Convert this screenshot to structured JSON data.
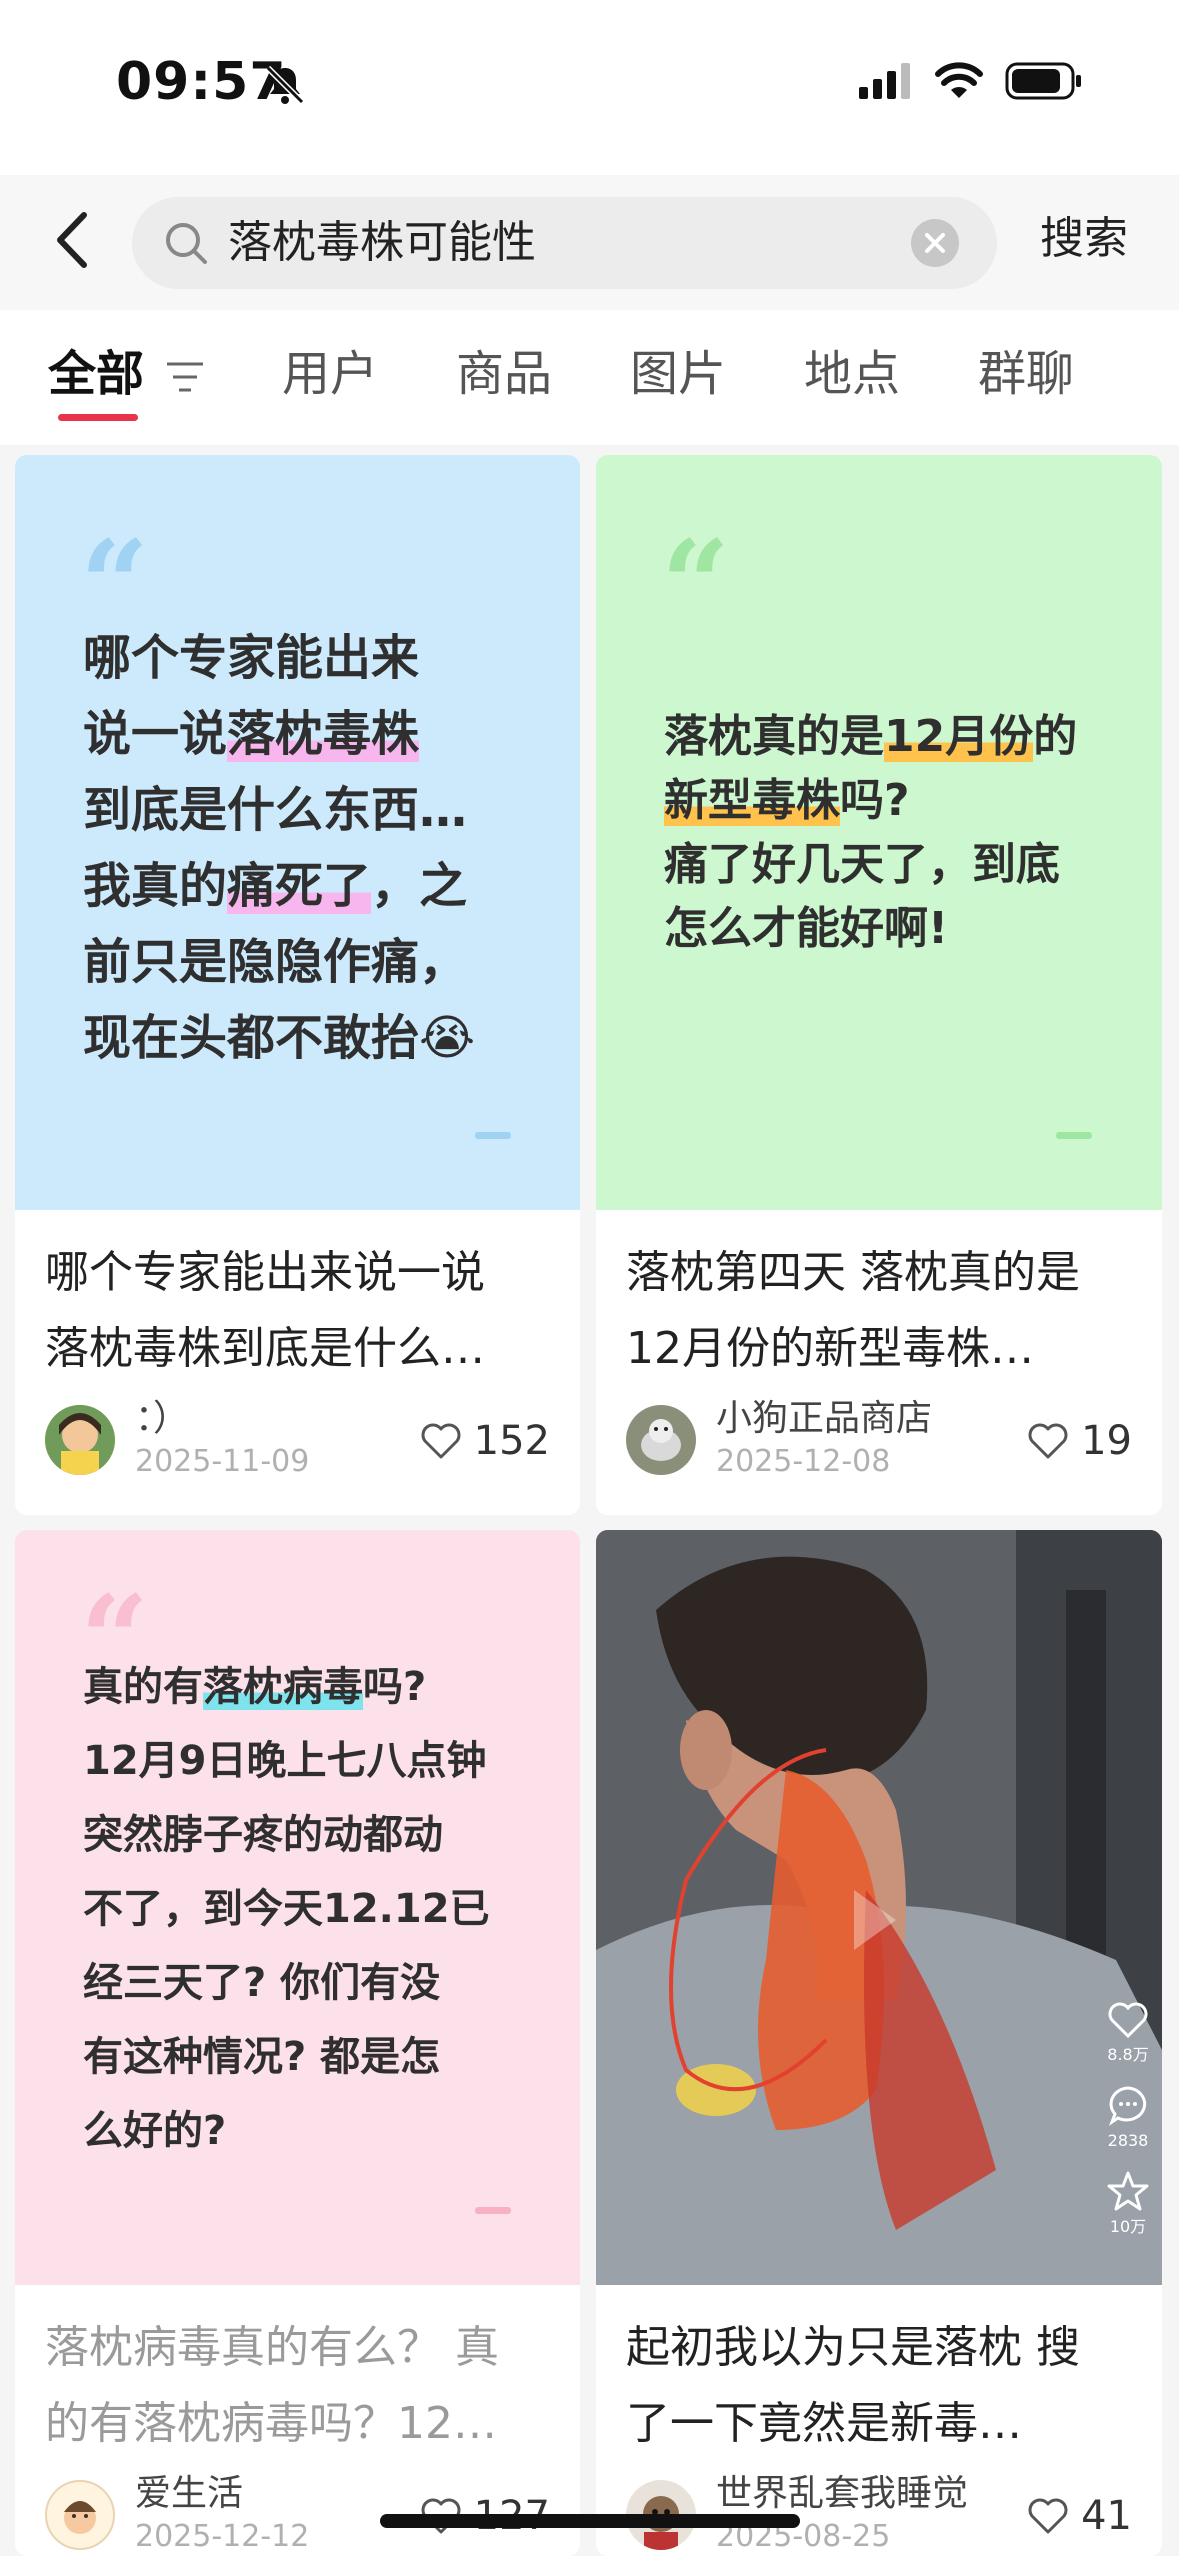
{
  "status_bar": {
    "time": "09:57"
  },
  "search": {
    "query": "落枕毒株可能性",
    "submit_label": "搜索"
  },
  "tabs": [
    {
      "label": "全部",
      "active": true
    },
    {
      "label": "用户"
    },
    {
      "label": "商品"
    },
    {
      "label": "图片"
    },
    {
      "label": "地点"
    },
    {
      "label": "群聊"
    }
  ],
  "posts": [
    {
      "cover_bg": "#cdeafd",
      "cover_lines": [
        [
          "哪个专家能出来"
        ],
        [
          "说一说",
          "落枕毒株",
          "|"
        ],
        [
          "到底是什么东西…"
        ],
        [
          "我真的",
          "痛死了",
          "，之"
        ],
        [
          "前只是隐隐作痛，"
        ],
        [
          "现在头都不敢抬",
          "😭"
        ]
      ],
      "title_line1": "哪个专家能出来说一说",
      "title_line2": "落枕毒株到底是什么…",
      "author": "：）",
      "date": "2025-11-09",
      "likes": "152"
    },
    {
      "cover_bg": "#cdf7cf",
      "cover_line1a": "落枕真的是",
      "cover_line1b": "12月份",
      "cover_line1c": "的",
      "cover_line2a": "新型毒株",
      "cover_line2b": "吗?",
      "cover_line3": "痛了好几天了，到底",
      "cover_line4": "怎么才能好啊!",
      "title_line1": "落枕第四天 落枕真的是",
      "title_line2": "12月份的新型毒株…",
      "author": "小狗正品商店",
      "date": "2025-12-08",
      "likes": "19"
    },
    {
      "cover_bg": "#fde1ea",
      "cover_line1a": "真的有",
      "cover_line1b": "落枕病毒",
      "cover_line1c": "吗?",
      "cover_line2": "12月9日晚上七八点钟",
      "cover_line3": "突然脖子疼的动都动",
      "cover_line4": "不了，到今天12.12已",
      "cover_line5": "经三天了? 你们有没",
      "cover_line6": "有这种情况? 都是怎",
      "cover_line7": "么好的?",
      "title_line1": "落枕病毒真的有么？ 真",
      "title_line2": "的有落枕病毒吗？12…",
      "author": "爱生活",
      "date": "2025-12-12",
      "likes": "127"
    },
    {
      "video_counts": {
        "likes": "8.8万",
        "comments": "2838",
        "favorites": "10万"
      },
      "title_line1": "起初我以为只是落枕 搜",
      "title_line2": "了一下竟然是新毒…",
      "author": "世界乱套我睡觉",
      "date": "2025-08-25",
      "likes": "41"
    }
  ]
}
